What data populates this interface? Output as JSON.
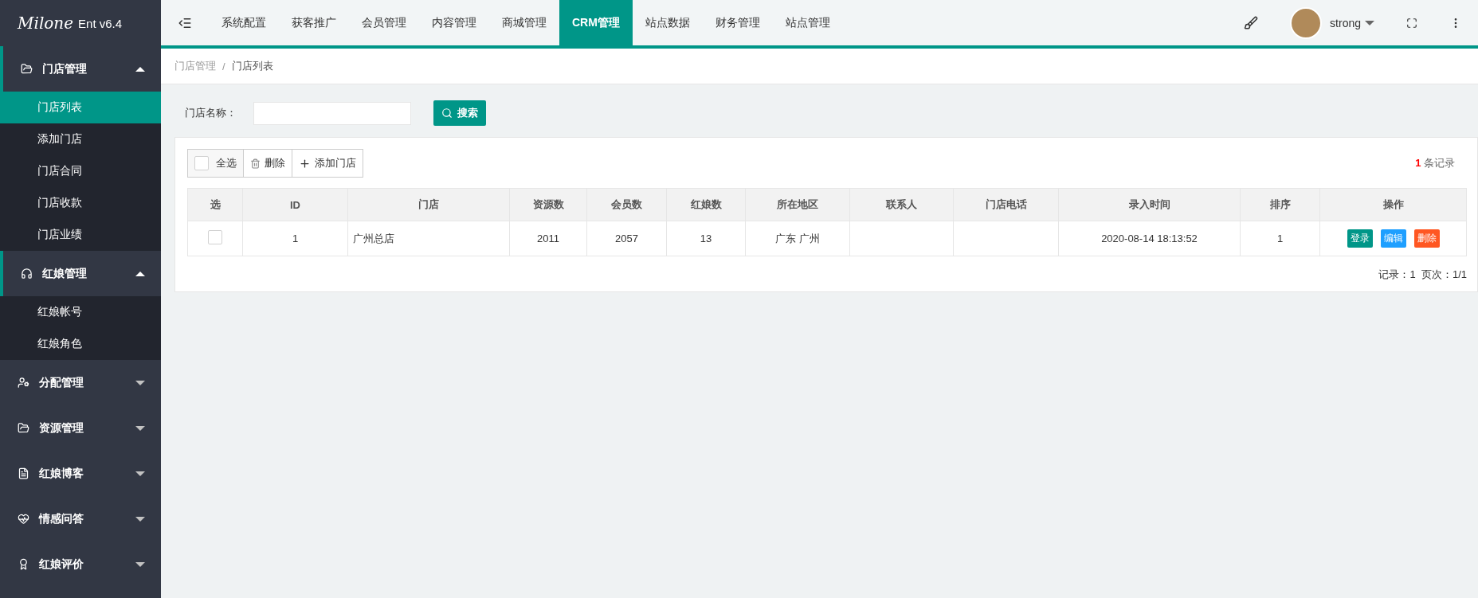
{
  "logo": {
    "script": "Milone",
    "version": "Ent v6.4"
  },
  "top_nav": [
    {
      "label": "系统配置",
      "selected": false
    },
    {
      "label": "获客推广",
      "selected": false
    },
    {
      "label": "会员管理",
      "selected": false
    },
    {
      "label": "内容管理",
      "selected": false
    },
    {
      "label": "商城管理",
      "selected": false
    },
    {
      "label": "CRM管理",
      "selected": true
    },
    {
      "label": "站点数据",
      "selected": false
    },
    {
      "label": "财务管理",
      "selected": false
    },
    {
      "label": "站点管理",
      "selected": false
    }
  ],
  "user": {
    "name": "strong"
  },
  "sidebar": [
    {
      "label": "门店管理",
      "expanded": true,
      "children": [
        {
          "label": "门店列表",
          "selected": true
        },
        {
          "label": "添加门店",
          "selected": false
        },
        {
          "label": "门店合同",
          "selected": false
        },
        {
          "label": "门店收款",
          "selected": false
        },
        {
          "label": "门店业绩",
          "selected": false
        }
      ]
    },
    {
      "label": "红娘管理",
      "expanded": true,
      "children": [
        {
          "label": "红娘帐号",
          "selected": false
        },
        {
          "label": "红娘角色",
          "selected": false
        }
      ]
    },
    {
      "label": "分配管理",
      "expanded": false
    },
    {
      "label": "资源管理",
      "expanded": false
    },
    {
      "label": "红娘博客",
      "expanded": false
    },
    {
      "label": "情感问答",
      "expanded": false
    },
    {
      "label": "红娘评价",
      "expanded": false
    }
  ],
  "breadcrumb": {
    "items": [
      "门店管理",
      "门店列表"
    ],
    "separator": "/"
  },
  "search": {
    "label": "门店名称：",
    "button": "搜索"
  },
  "toolbar": {
    "select_all": "全选",
    "select_all_checked": false,
    "delete": "删除",
    "add": "添加门店"
  },
  "record_count": {
    "count": "1",
    "label": "条记录"
  },
  "table": {
    "columns": [
      "选",
      "ID",
      "门店",
      "资源数",
      "会员数",
      "红娘数",
      "所在地区",
      "联系人",
      "门店电话",
      "录入时间",
      "排序",
      "操作"
    ],
    "rows": [
      {
        "checked": false,
        "cells": [
          "",
          "1",
          "广州总店",
          "2011",
          "2057",
          "13",
          "广东 广州",
          "",
          "",
          "2020-08-14 18:13:52",
          "1"
        ],
        "actions": [
          {
            "label": "登录",
            "kind": "login"
          },
          {
            "label": "编辑",
            "kind": "edit"
          },
          {
            "label": "删除",
            "kind": "delete"
          }
        ]
      }
    ]
  },
  "pagination": "记录：1  页次：1/1"
}
